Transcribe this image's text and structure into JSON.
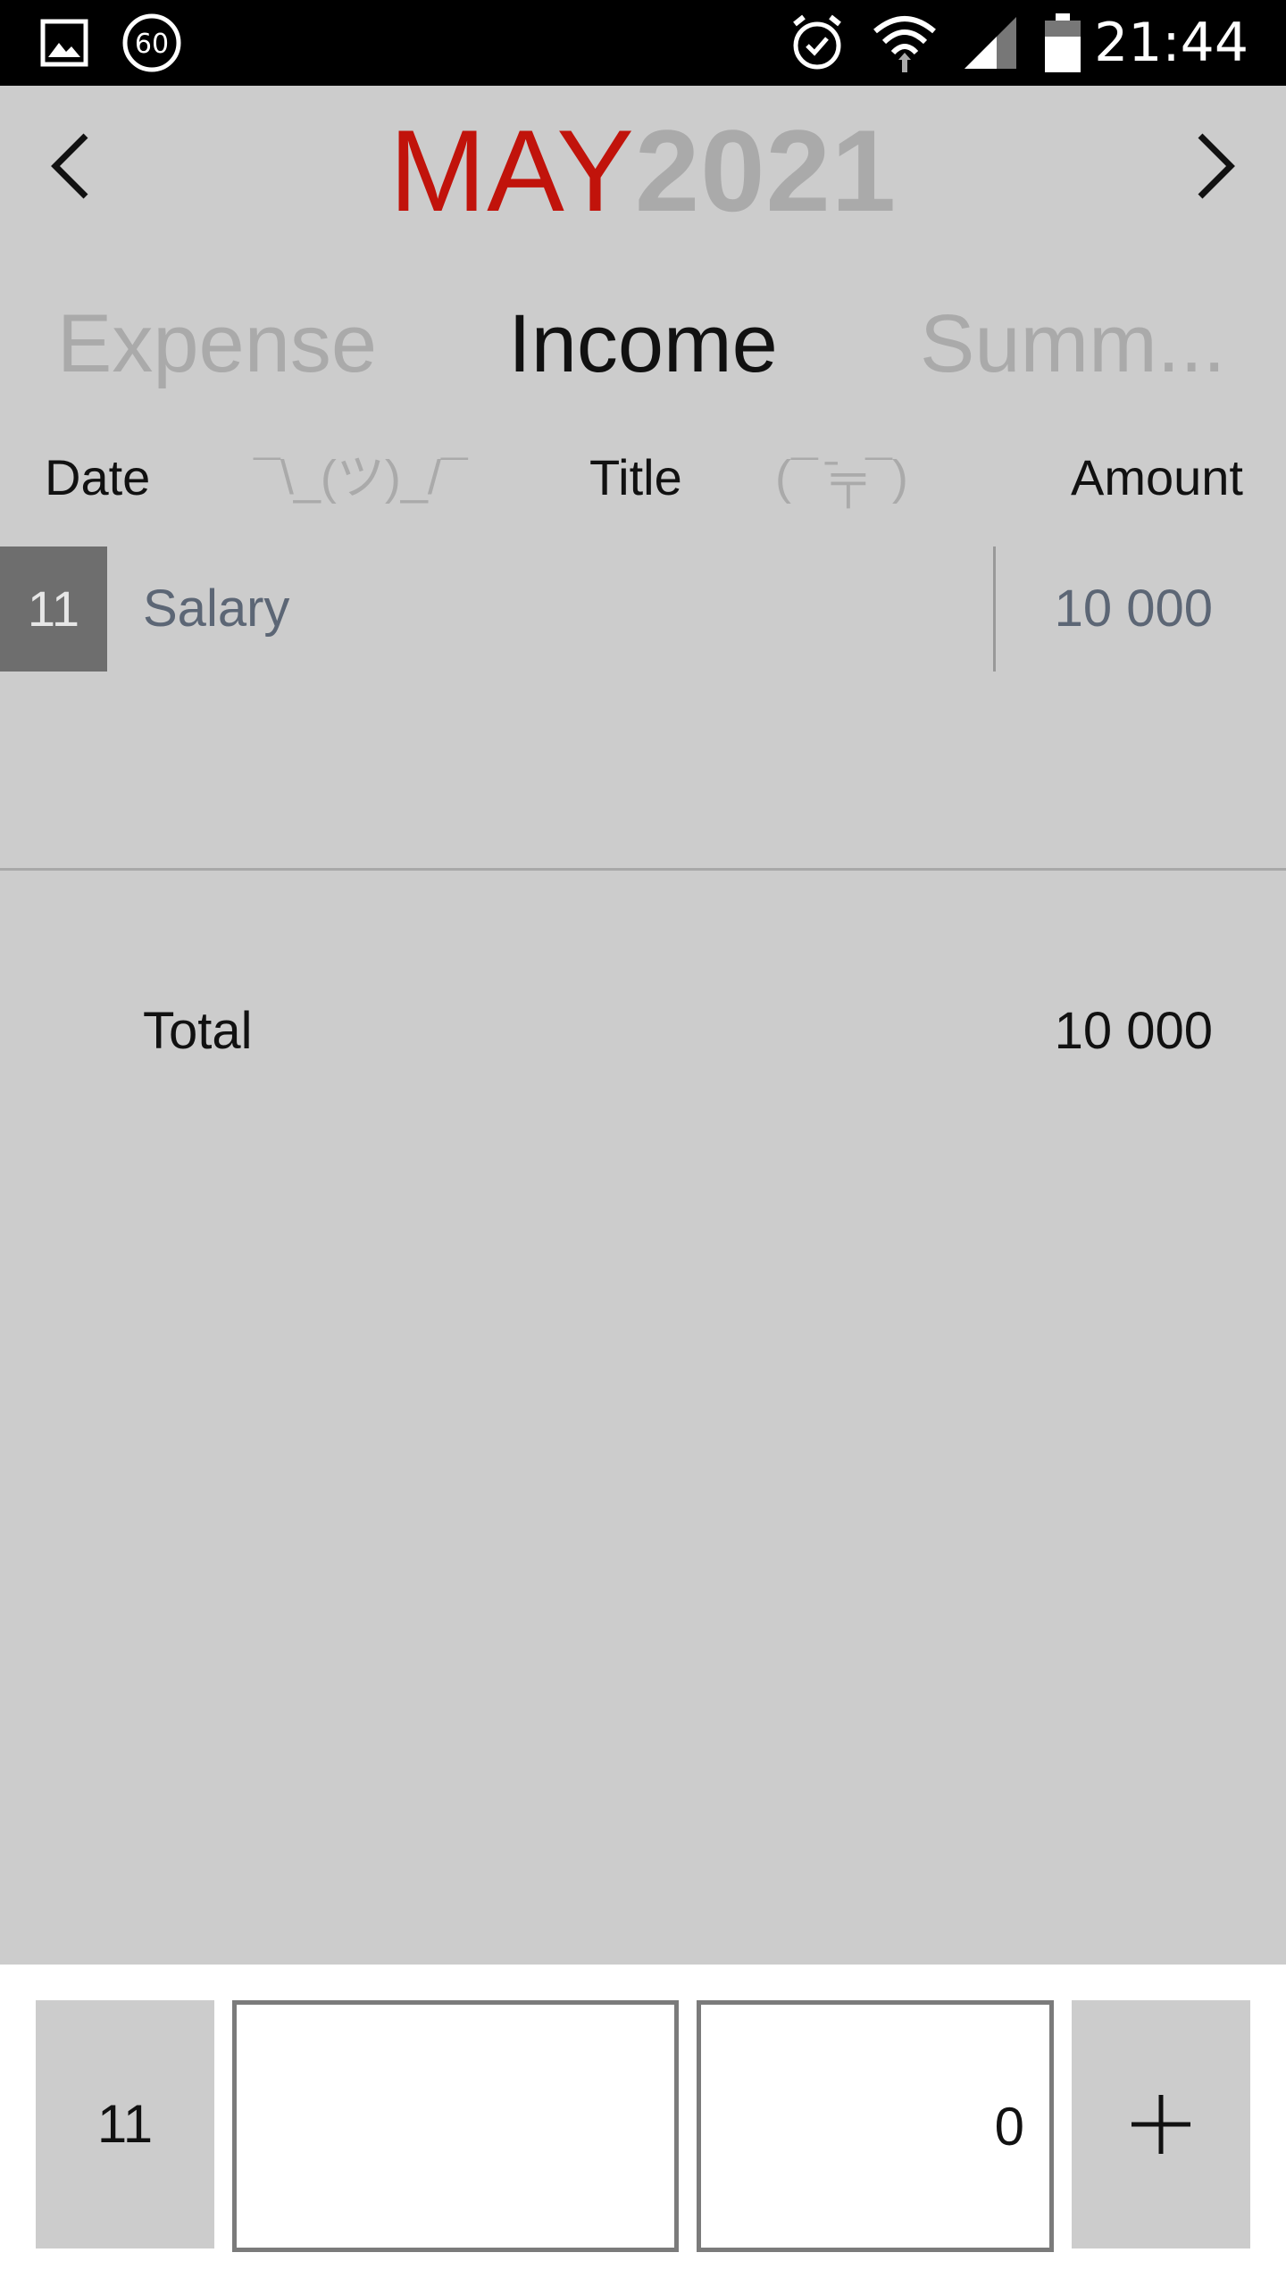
{
  "status_bar": {
    "time": "21:44",
    "badge": "60",
    "icons": [
      "gallery-icon",
      "sixty-badge-icon",
      "alarm-icon",
      "wifi-icon",
      "signal-icon",
      "battery-icon"
    ]
  },
  "header": {
    "month": "MAY",
    "year": "2021",
    "colors": {
      "month": "#c1130b",
      "year": "#aaaaaa"
    }
  },
  "tabs": [
    {
      "label": "Expense",
      "active": false
    },
    {
      "label": "Income",
      "active": true
    },
    {
      "label": "Summ...",
      "active": false
    }
  ],
  "table": {
    "columns": {
      "date": "Date",
      "title": "Title",
      "amount": "Amount",
      "emoticon_left": "¯\\_(ツ)_/¯",
      "emoticon_right": "(¯ ̄╤¯)"
    },
    "rows": [
      {
        "date": "11",
        "title": "Salary",
        "amount": "10 000"
      }
    ]
  },
  "total": {
    "label": "Total",
    "value": "10 000"
  },
  "entry": {
    "day": "11",
    "title_value": "",
    "amount_value": "0",
    "add_icon": "plus-icon"
  }
}
